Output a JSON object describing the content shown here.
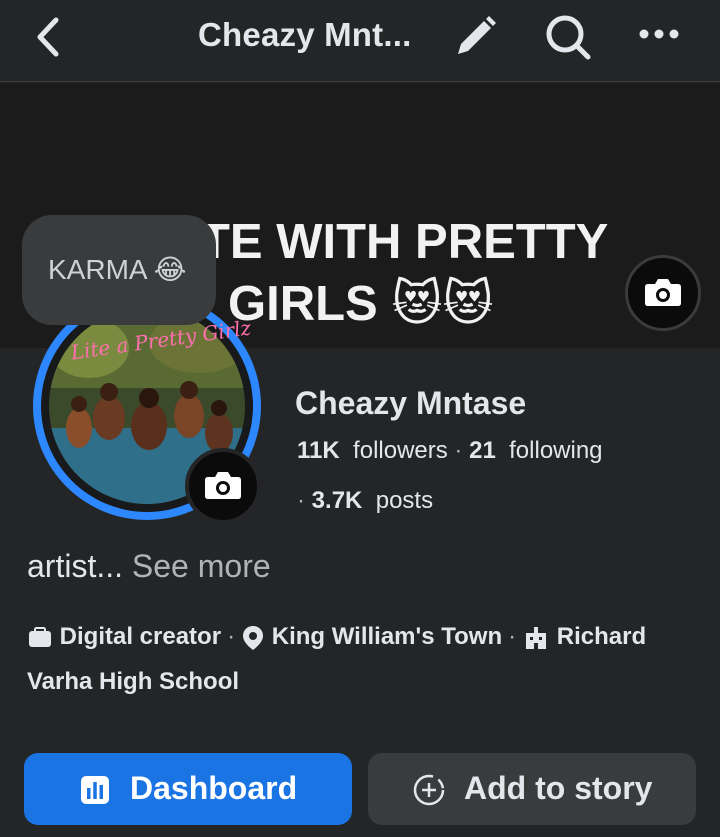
{
  "header": {
    "title": "Cheazy Mnt...",
    "icons": [
      "back-arrow-icon",
      "pencil-icon",
      "search-icon",
      "more-icon"
    ]
  },
  "cover": {
    "line1": "TE WITH PRETTY",
    "line2": "GIRLS 😻😻"
  },
  "note": {
    "text": "KARMA 😂"
  },
  "profile": {
    "avatar_text": "Lite a Pretty Girlz",
    "name": "Cheazy Mntase",
    "followers_count": "11K",
    "followers_label": "followers",
    "following_count": "21",
    "following_label": "following",
    "posts_count": "3.7K",
    "posts_label": "posts",
    "separator": "·"
  },
  "bio": {
    "text": "artist...",
    "see_more": "See more"
  },
  "details": {
    "category": "Digital creator",
    "location": "King William's Town",
    "education": "Richard Varha High School"
  },
  "actions": {
    "dashboard": "Dashboard",
    "add_story": "Add to story"
  },
  "colors": {
    "background": "#242526",
    "accent": "#1b74e4",
    "ring": "#2d88ff",
    "secondary_button": "#3a3b3c"
  }
}
